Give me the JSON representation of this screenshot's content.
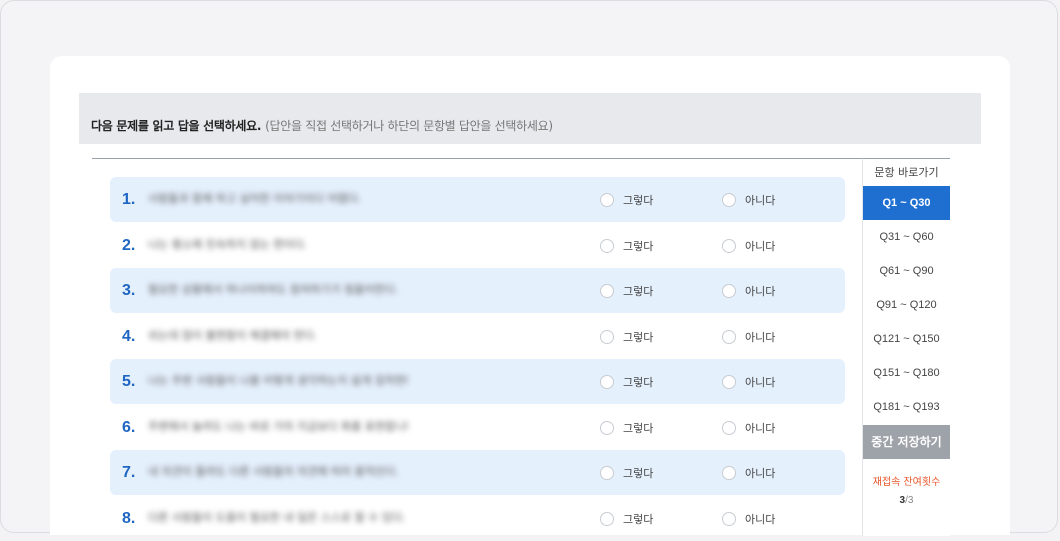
{
  "instruction": {
    "main": "다음 문제를 읽고 답을 선택하세요.",
    "sub": "(답안을 직접 선택하거나 하단의 문항별 답안을 선택하세요)"
  },
  "options": {
    "yes": "그렇다",
    "no": "아니다"
  },
  "questions": [
    {
      "num": "1.",
      "text": "사람들과 함께 하고 싶어한 이야기이다 어렵다.",
      "shaded": true
    },
    {
      "num": "2.",
      "text": "나는 평소에 친숙하지 않는 편이다.",
      "shaded": false
    },
    {
      "num": "3.",
      "text": "필요한 상황에서 하나이하여도 참여하기가 힘들어한다.",
      "shaded": true
    },
    {
      "num": "4.",
      "text": "쉬는데 많이 불편함이 해결해야 한다.",
      "shaded": false
    },
    {
      "num": "5.",
      "text": "나는 주변 사람들이 나를 어떻게 생각하는지 쉽게 짐작한다.",
      "shaded": true
    },
    {
      "num": "6.",
      "text": "주변에서 놀려도 나는 바로 거의 지금보다 화를 표현합니다.",
      "shaded": false
    },
    {
      "num": "7.",
      "text": "내 의견이 틀려도 다른 사람들의 의견에 따라 움직인다.",
      "shaded": true
    },
    {
      "num": "8.",
      "text": "다른 사람들이 도움이 필요한 내 일은 스스로 할 수 있다.",
      "shaded": false
    }
  ],
  "nav": {
    "title": "문항 바로가기",
    "items": [
      "Q1 ~ Q30",
      "Q31 ~ Q60",
      "Q61 ~ Q90",
      "Q91 ~ Q120",
      "Q121 ~ Q150",
      "Q151 ~ Q180",
      "Q181 ~ Q193"
    ],
    "active_index": 0,
    "save_label": "중간 저장하기",
    "retry_label": "재접속 잔여횟수",
    "retry_current": "3",
    "retry_sep": "/",
    "retry_total": "3"
  }
}
